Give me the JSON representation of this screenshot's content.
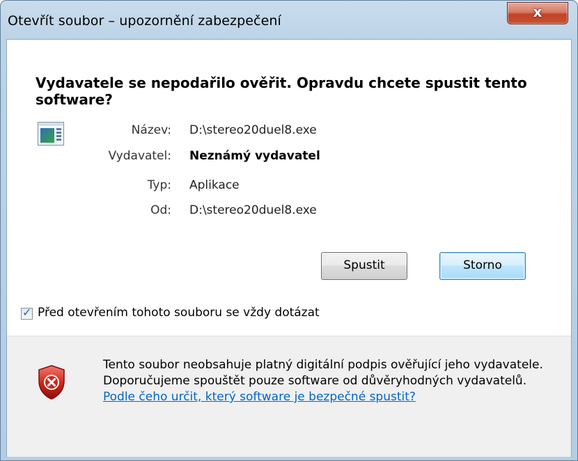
{
  "window": {
    "title": "Otevřít soubor – upozornění zabezpečení",
    "close_label": "x"
  },
  "dialog": {
    "heading": "Vydavatele se nepodařilo ověřit. Opravdu chcete spustit tento software?",
    "app_icon": "application-icon",
    "fields": [
      {
        "label": "Název:",
        "value": "D:\\stereo20duel8.exe"
      },
      {
        "label": "Vydavatel:",
        "value": "Neznámý vydavatel"
      },
      {
        "label": "Typ:",
        "value": "Aplikace"
      },
      {
        "label": "Od:",
        "value": "D:\\stereo20duel8.exe"
      }
    ],
    "buttons": {
      "run_label": "Spustit",
      "cancel_label": "Storno"
    },
    "checkbox": {
      "label": "Před otevřením tohoto souboru se vždy dotázat",
      "checked": true
    }
  },
  "warning": {
    "icon": "shield-error-icon",
    "text": "Tento soubor neobsahuje platný digitální podpis ověřující jeho vydavatele. Doporučujeme spouštět pouze software od důvěryhodných vydavatelů.",
    "link_text": "Podle čeho určit, který software je bezpečné spustit?"
  }
}
